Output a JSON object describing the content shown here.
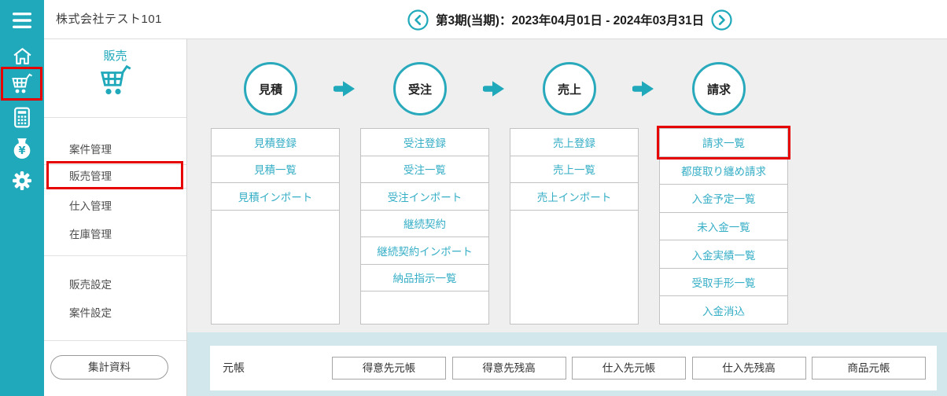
{
  "topbar": {
    "company": "株式会社テスト101",
    "period": "第3期(当期)：2023年04月01日 - 2024年03月31日",
    "prev_icon": "chevron-left-circle",
    "next_icon": "chevron-right-circle"
  },
  "iconbar": {
    "icons": [
      {
        "name": "menu-icon"
      },
      {
        "name": "home-icon"
      },
      {
        "name": "cart-icon",
        "highlighted": true
      },
      {
        "name": "calculator-icon"
      },
      {
        "name": "money-bag-icon"
      },
      {
        "name": "gear-icon"
      }
    ]
  },
  "sidebar": {
    "title": "販売",
    "title_icon": "cart-icon",
    "items": [
      {
        "label": "案件管理",
        "selected": false
      },
      {
        "label": "販売管理",
        "selected": true
      },
      {
        "label": "仕入管理",
        "selected": false
      },
      {
        "label": "在庫管理",
        "selected": false
      }
    ],
    "settings_items": [
      {
        "label": "販売設定"
      },
      {
        "label": "案件設定"
      }
    ],
    "footer_button": "集計資料"
  },
  "flow": {
    "steps": [
      {
        "label": "見積",
        "buttons": [
          "見積登録",
          "見積一覧",
          "見積インポート"
        ]
      },
      {
        "label": "受注",
        "buttons": [
          "受注登録",
          "受注一覧",
          "受注インポート",
          "継続契約",
          "継続契約インポート",
          "納品指示一覧"
        ]
      },
      {
        "label": "売上",
        "buttons": [
          "売上登録",
          "売上一覧",
          "売上インポート"
        ]
      },
      {
        "label": "請求",
        "buttons": [
          "請求一覧",
          "都度取り纏め請求",
          "入金予定一覧",
          "未入金一覧",
          "入金実績一覧",
          "受取手形一覧",
          "入金消込"
        ]
      }
    ],
    "arrow_icon": "arrow-right"
  },
  "ledger": {
    "label": "元帳",
    "buttons": [
      "得意先元帳",
      "得意先残高",
      "仕入先元帳",
      "仕入先残高",
      "商品元帳"
    ]
  },
  "annotations": {
    "color": "#e60000",
    "targets": [
      "cart-icon",
      "販売管理",
      "請求一覧"
    ]
  },
  "colors": {
    "accent_teal": "#1fa9ba",
    "link_teal": "#35aec6",
    "band_blue": "#d2e7ec",
    "main_gray": "#efefef",
    "annotation_red": "#e60000"
  }
}
